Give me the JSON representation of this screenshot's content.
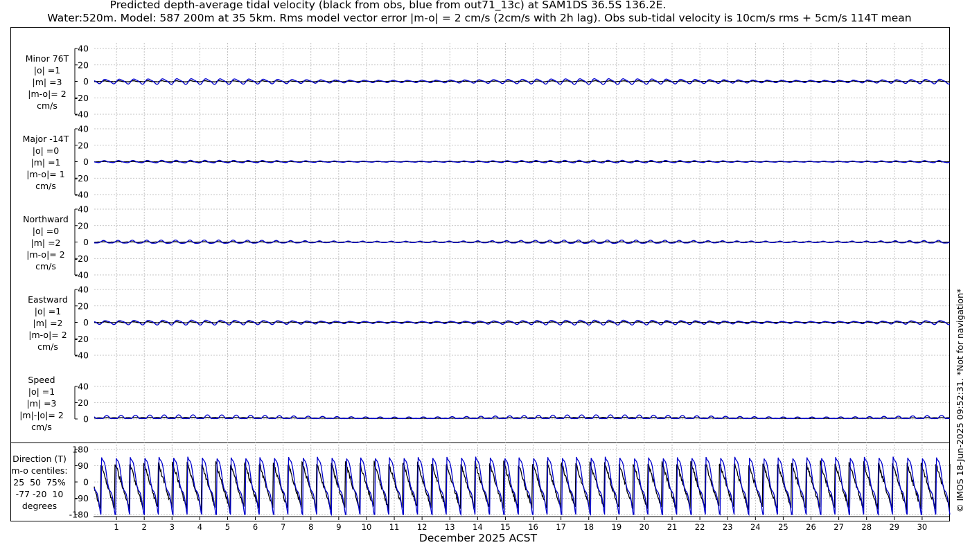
{
  "title_line1": "Predicted depth-average tidal velocity (black from obs, blue from out71_13c) at SAM1DS 36.5S 136.2E.",
  "title_line2": "Water:520m. Model: 587 200m at 35 5km. Rms model vector error |m-o| = 2 cm/s (2cm/s with 2h lag). Obs sub-tidal velocity is 10cm/s rms + 5cm/s 114T mean",
  "copyright": "© IMOS 18-Jun-2025 09:52:31. *Not for navigation*",
  "colors": {
    "obs": "#000000",
    "model": "#0000cc",
    "grid": "#b3b3b3"
  },
  "chart_data": {
    "type": "line",
    "xlabel": "December 2025 ACST",
    "x_ticks": [
      "1",
      "2",
      "3",
      "4",
      "5",
      "6",
      "7",
      "8",
      "9",
      "10",
      "11",
      "12",
      "13",
      "14",
      "15",
      "16",
      "17",
      "18",
      "19",
      "20",
      "21",
      "22",
      "23",
      "24",
      "25",
      "26",
      "27",
      "28",
      "29",
      "30"
    ],
    "x_range_days": [
      0.2,
      31.0
    ],
    "panels": [
      {
        "name": "minor",
        "label": "Minor 76T\n|o| =1\n|m| =3\n|m-o|= 2\ncm/s",
        "ylim": [
          -40,
          40
        ],
        "yticks": [
          -40,
          -20,
          0,
          20,
          40
        ],
        "ytick_labels": [
          "-40",
          "-20",
          "0",
          "20",
          "40"
        ],
        "obs_amp": 1.0,
        "model_amp": 3.2,
        "phase": 0.3,
        "kind": "signed"
      },
      {
        "name": "major",
        "label": "Major -14T\n|o| =0\n|m| =1\n|m-o|= 1\ncm/s",
        "ylim": [
          -40,
          40
        ],
        "yticks": [
          -40,
          -20,
          0,
          20,
          40
        ],
        "ytick_labels": [
          "-40",
          "-20",
          "0",
          "20",
          "40"
        ],
        "obs_amp": 0.5,
        "model_amp": 1.5,
        "phase": 0.9,
        "kind": "signed"
      },
      {
        "name": "northward",
        "label": "Northward\n|o| =0\n|m| =2\n|m-o|= 2\ncm/s",
        "ylim": [
          -40,
          40
        ],
        "yticks": [
          -40,
          -20,
          0,
          20,
          40
        ],
        "ytick_labels": [
          "-40",
          "-20",
          "0",
          "20",
          "40"
        ],
        "obs_amp": 0.6,
        "model_amp": 2.0,
        "phase": 1.4,
        "kind": "signed"
      },
      {
        "name": "eastward",
        "label": "Eastward\n|o| =1\n|m| =2\n|m-o|= 2\ncm/s",
        "ylim": [
          -40,
          40
        ],
        "yticks": [
          -40,
          -20,
          0,
          20,
          40
        ],
        "ytick_labels": [
          "-40",
          "-20",
          "0",
          "20",
          "40"
        ],
        "obs_amp": 1.0,
        "model_amp": 2.8,
        "phase": 0.2,
        "kind": "signed"
      },
      {
        "name": "speed",
        "label": "Speed\n|o| =1\n|m| =3\n|m|-|o|= 2\ncm/s",
        "ylim": [
          0,
          40
        ],
        "yticks": [
          0,
          20,
          40
        ],
        "ytick_labels": [
          "0",
          "20",
          "40"
        ],
        "obs_amp": 1.2,
        "model_amp": 3.0,
        "phase": 0.0,
        "kind": "speed"
      },
      {
        "name": "direction",
        "label": "Direction (T)\nm-o centiles:\n25  50  75%\n-77 -20  10\ndegrees",
        "ylim": [
          -180,
          180
        ],
        "yticks": [
          -180,
          -90,
          0,
          90,
          180
        ],
        "ytick_labels": [
          "-180",
          "-90",
          "0",
          "90",
          "180"
        ],
        "kind": "direction"
      }
    ]
  }
}
